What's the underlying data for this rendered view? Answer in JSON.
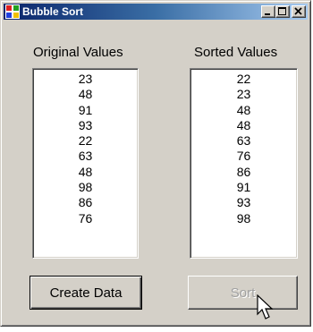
{
  "window": {
    "title": "Bubble Sort",
    "icon": "windows-app-icon",
    "controls": [
      "minimize-icon",
      "maximize-icon",
      "close-icon"
    ]
  },
  "original": {
    "label": "Original Values",
    "items": [
      "23",
      "48",
      "91",
      "93",
      "22",
      "63",
      "48",
      "98",
      "86",
      "76"
    ]
  },
  "sorted": {
    "label": "Sorted Values",
    "items": [
      "22",
      "23",
      "48",
      "48",
      "63",
      "76",
      "86",
      "91",
      "93",
      "98"
    ]
  },
  "buttons": {
    "create_label": "Create Data",
    "sort_label": "Sort",
    "sort_state": "disabled"
  },
  "cursor": "arrow-cursor-icon",
  "colors": {
    "titlebar_start": "#0a246a",
    "titlebar_end": "#a6caf0",
    "face": "#d4d0c8"
  }
}
